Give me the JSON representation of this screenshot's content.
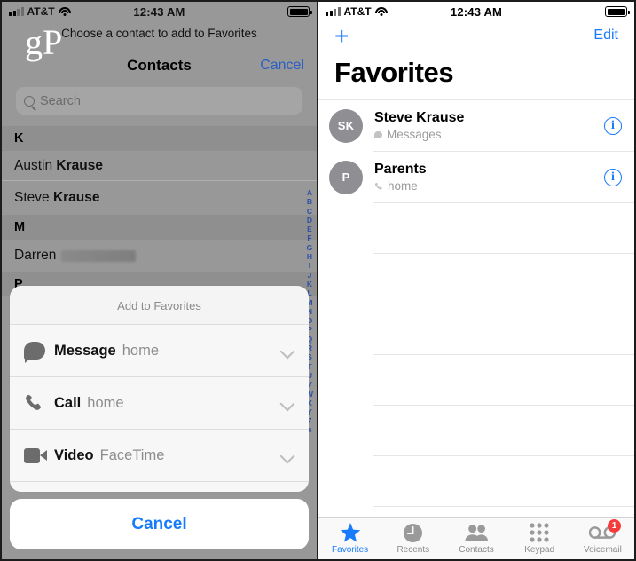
{
  "status_bar": {
    "carrier": "AT&T",
    "time": "12:43 AM",
    "signal_icon": "signal-bars-icon",
    "wifi_icon": "wifi-icon",
    "battery_icon": "battery-full-icon"
  },
  "watermark": {
    "text": "gP"
  },
  "left_screen": {
    "instruction": "Choose a contact to add to Favorites",
    "nav": {
      "title": "Contacts",
      "cancel_label": "Cancel"
    },
    "search": {
      "placeholder": "Search",
      "value": "",
      "icon": "search-icon"
    },
    "sections": [
      {
        "letter": "K",
        "contacts": [
          {
            "first": "Austin",
            "last": "Krause",
            "redacted": false
          },
          {
            "first": "Steve",
            "last": "Krause",
            "redacted": false
          }
        ]
      },
      {
        "letter": "M",
        "contacts": [
          {
            "first": "Darren",
            "last": "",
            "redacted": true
          }
        ]
      },
      {
        "letter": "P",
        "contacts": []
      }
    ],
    "alpha_index": [
      "A",
      "B",
      "C",
      "D",
      "E",
      "F",
      "G",
      "H",
      "I",
      "J",
      "K",
      "L",
      "M",
      "N",
      "O",
      "P",
      "Q",
      "R",
      "S",
      "T",
      "U",
      "V",
      "W",
      "X",
      "Y",
      "Z",
      "#"
    ],
    "action_sheet": {
      "title": "Add to Favorites",
      "options": [
        {
          "label": "Message",
          "detail": "home",
          "icon": "message-bubble-icon",
          "chevron": "chevron-down-icon"
        },
        {
          "label": "Call",
          "detail": "home",
          "icon": "phone-icon",
          "chevron": "chevron-down-icon"
        },
        {
          "label": "Video",
          "detail": "FaceTime",
          "icon": "video-camera-icon",
          "chevron": "chevron-down-icon"
        }
      ],
      "cancel_label": "Cancel"
    }
  },
  "right_screen": {
    "add_label": "+",
    "edit_label": "Edit",
    "title": "Favorites",
    "favorites": [
      {
        "initials": "SK",
        "name": "Steve Krause",
        "meta": "Messages",
        "meta_icon": "message-bubble-icon",
        "info_icon": "info-circle-icon"
      },
      {
        "initials": "P",
        "name": "Parents",
        "meta": "home",
        "meta_icon": "phone-icon",
        "info_icon": "info-circle-icon"
      }
    ],
    "empty_row_count": 7,
    "tabs": [
      {
        "label": "Favorites",
        "icon": "star-icon",
        "active": true,
        "badge": ""
      },
      {
        "label": "Recents",
        "icon": "clock-icon",
        "active": false,
        "badge": ""
      },
      {
        "label": "Contacts",
        "icon": "people-icon",
        "active": false,
        "badge": ""
      },
      {
        "label": "Keypad",
        "icon": "keypad-icon",
        "active": false,
        "badge": ""
      },
      {
        "label": "Voicemail",
        "icon": "voicemail-icon",
        "active": false,
        "badge": "1"
      }
    ]
  },
  "colors": {
    "accent_blue": "#177bfb",
    "dim_overlay": "#989898",
    "badge_red": "#f43c3c",
    "avatar_gray": "#8e8e93"
  }
}
